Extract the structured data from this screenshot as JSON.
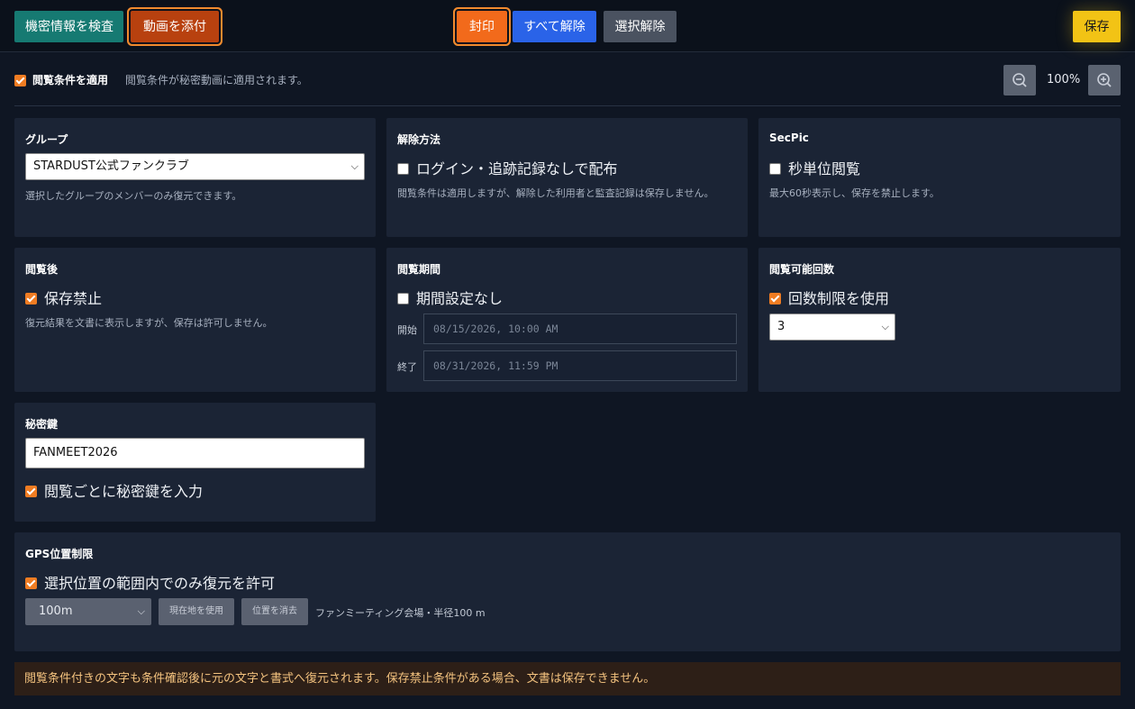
{
  "toolbar": {
    "inspect_label": "機密情報を検査",
    "attach_label": "動画を添付",
    "seal_label": "封印",
    "unseal_all_label": "すべて解除",
    "deselect_label": "選択解除",
    "save_label": "保存"
  },
  "apply": {
    "checked": true,
    "label": "閲覧条件を適用",
    "hint": "閲覧条件が秘密動画に適用されます。"
  },
  "zoom": {
    "value": "100%",
    "zoom_out_icon": "zoom-out-icon",
    "zoom_in_icon": "zoom-in-icon"
  },
  "group": {
    "title": "グループ",
    "selected": "STARDUST公式ファンクラブ",
    "desc": "選択したグループのメンバーのみ復元できます。"
  },
  "unlock": {
    "title": "解除方法",
    "option_label": "ログイン・追跡記録なしで配布",
    "checked": false,
    "desc": "閲覧条件は適用しますが、解除した利用者と監査記録は保存しません。"
  },
  "secpic": {
    "title": "SecPic",
    "option_label": "秒単位閲覧",
    "checked": false,
    "desc": "最大60秒表示し、保存を禁止します。"
  },
  "after_view": {
    "title": "閲覧後",
    "option_label": "保存禁止",
    "checked": true,
    "desc": "復元結果を文書に表示しますが、保存は許可しません。"
  },
  "period": {
    "title": "閲覧期間",
    "option_label": "期間設定なし",
    "checked": false,
    "start_label": "開始",
    "start_value": "08/15/2026, 10:00 AM",
    "end_label": "終了",
    "end_value": "08/31/2026, 11:59 PM"
  },
  "count": {
    "title": "閲覧可能回数",
    "option_label": "回数制限を使用",
    "checked": true,
    "selected": "3"
  },
  "secret": {
    "title": "秘密鍵",
    "value": "FANMEET2026",
    "option_label": "閲覧ごとに秘密鍵を入力",
    "checked": true
  },
  "gps": {
    "title": "GPS位置制限",
    "option_label": "選択位置の範囲内でのみ復元を許可",
    "checked": true,
    "radius": "100m",
    "use_current_label": "現在地を使用",
    "clear_label": "位置を消去",
    "location_text": "ファンミーティング会場・半径100 m"
  },
  "footer_note": "閲覧条件付きの文字も条件確認後に元の文字と書式へ復元されます。保存禁止条件がある場合、文書は保存できません。"
}
